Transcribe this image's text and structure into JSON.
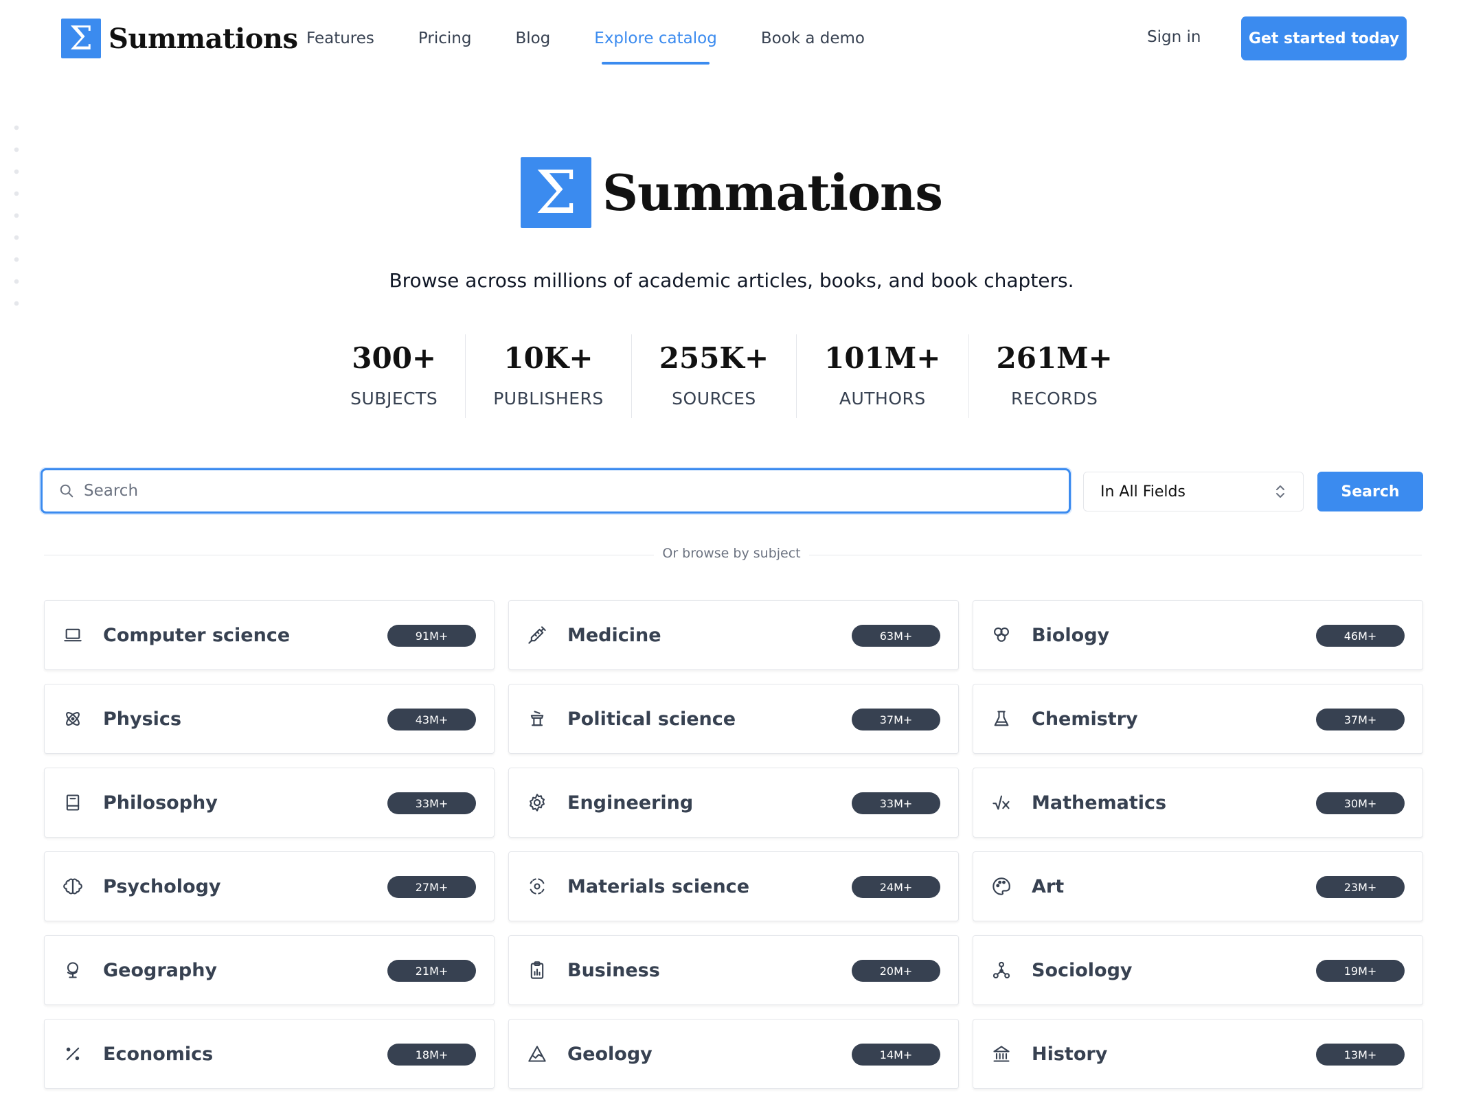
{
  "header": {
    "brand_glyph": "Σ",
    "brand_name": "Summations",
    "nav": [
      {
        "label": "Features",
        "active": false
      },
      {
        "label": "Pricing",
        "active": false
      },
      {
        "label": "Blog",
        "active": false
      },
      {
        "label": "Explore catalog",
        "active": true
      },
      {
        "label": "Book a demo",
        "active": false
      }
    ],
    "signin_label": "Sign in",
    "cta_label": "Get started today"
  },
  "hero": {
    "logo_glyph": "Σ",
    "title": "Summations",
    "tagline": "Browse across millions of academic articles, books, and book chapters."
  },
  "stats": [
    {
      "value": "300+",
      "label": "SUBJECTS"
    },
    {
      "value": "10K+",
      "label": "PUBLISHERS"
    },
    {
      "value": "255K+",
      "label": "SOURCES"
    },
    {
      "value": "101M+",
      "label": "AUTHORS"
    },
    {
      "value": "261M+",
      "label": "RECORDS"
    }
  ],
  "search": {
    "placeholder": "Search",
    "value": "",
    "field_select": "In All Fields",
    "button_label": "Search"
  },
  "browse_label": "Or browse by subject",
  "subjects": [
    {
      "label": "Computer science",
      "count": "91M+",
      "icon": "laptop-icon"
    },
    {
      "label": "Medicine",
      "count": "63M+",
      "icon": "syringe-icon"
    },
    {
      "label": "Biology",
      "count": "46M+",
      "icon": "cells-icon"
    },
    {
      "label": "Physics",
      "count": "43M+",
      "icon": "atom-icon"
    },
    {
      "label": "Political science",
      "count": "37M+",
      "icon": "podium-icon"
    },
    {
      "label": "Chemistry",
      "count": "37M+",
      "icon": "flask-icon"
    },
    {
      "label": "Philosophy",
      "count": "33M+",
      "icon": "book-icon"
    },
    {
      "label": "Engineering",
      "count": "33M+",
      "icon": "gear-icon"
    },
    {
      "label": "Mathematics",
      "count": "30M+",
      "icon": "sqrt-icon"
    },
    {
      "label": "Psychology",
      "count": "27M+",
      "icon": "brain-icon"
    },
    {
      "label": "Materials science",
      "count": "24M+",
      "icon": "molecule-icon"
    },
    {
      "label": "Art",
      "count": "23M+",
      "icon": "palette-icon"
    },
    {
      "label": "Geography",
      "count": "21M+",
      "icon": "globe-icon"
    },
    {
      "label": "Business",
      "count": "20M+",
      "icon": "clipboard-chart-icon"
    },
    {
      "label": "Sociology",
      "count": "19M+",
      "icon": "network-icon"
    },
    {
      "label": "Economics",
      "count": "18M+",
      "icon": "percent-icon"
    },
    {
      "label": "Geology",
      "count": "14M+",
      "icon": "mountain-icon"
    },
    {
      "label": "History",
      "count": "13M+",
      "icon": "building-columns-icon"
    }
  ],
  "colors": {
    "accent": "#3b8bef",
    "badge": "#374151",
    "text": "#374151"
  }
}
